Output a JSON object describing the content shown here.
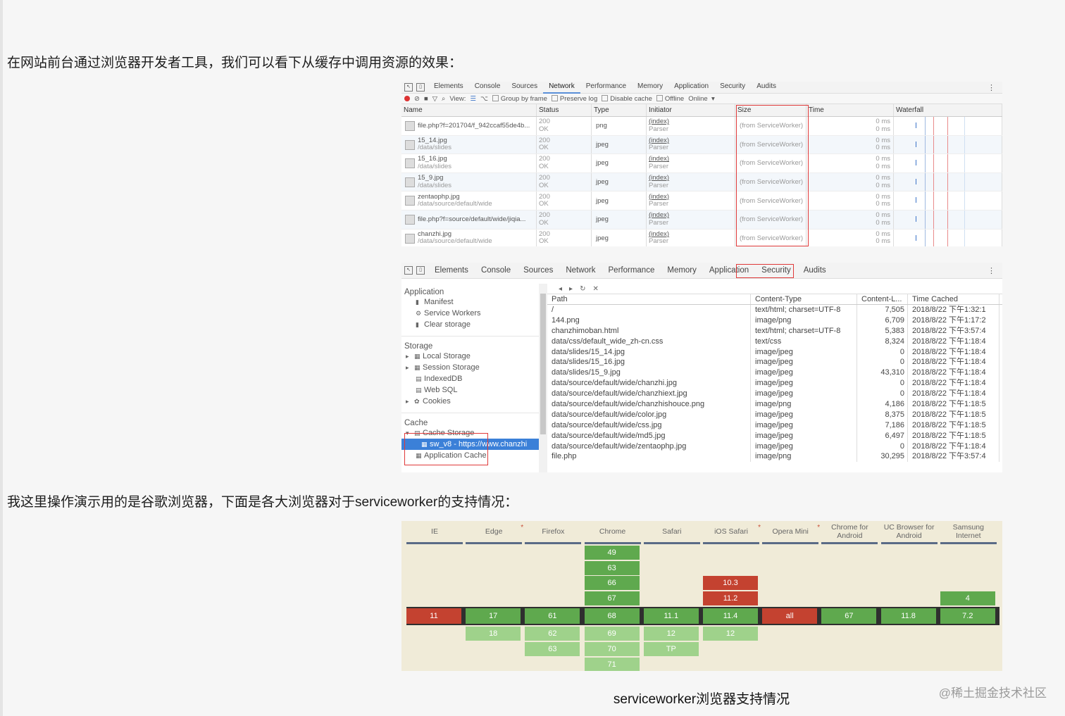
{
  "text": {
    "para1": "在网站前台通过浏览器开发者工具，我们可以看下从缓存中调用资源的效果：",
    "para2": "我这里操作演示用的是谷歌浏览器，下面是各大浏览器对于serviceworker的支持情况：",
    "caption": "serviceworker浏览器支持情况",
    "watermark": "@稀土掘金技术社区"
  },
  "devtools_network": {
    "tabs": [
      "Elements",
      "Console",
      "Sources",
      "Network",
      "Performance",
      "Memory",
      "Application",
      "Security",
      "Audits"
    ],
    "active_tab": "Network",
    "toolbar": {
      "view": "View:",
      "group_by_frame": "Group by frame",
      "preserve_log": "Preserve log",
      "disable_cache": "Disable cache",
      "offline": "Offline",
      "online": "Online"
    },
    "columns": [
      "Name",
      "Status",
      "Type",
      "Initiator",
      "Size",
      "Time",
      "Waterfall"
    ],
    "rows": [
      {
        "name": "file.php?f=201704/f_942ccaf55de4b...",
        "path": "",
        "status": "200",
        "status_text": "OK",
        "type": "png",
        "initiator": "(index)",
        "initiator_sub": "Parser",
        "size": "(from ServiceWorker)",
        "time": "0 ms",
        "latency": "0 ms"
      },
      {
        "name": "15_14.jpg",
        "path": "/data/slides",
        "status": "200",
        "status_text": "OK",
        "type": "jpeg",
        "initiator": "(index)",
        "initiator_sub": "Parser",
        "size": "(from ServiceWorker)",
        "time": "0 ms",
        "latency": "0 ms"
      },
      {
        "name": "15_16.jpg",
        "path": "/data/slides",
        "status": "200",
        "status_text": "OK",
        "type": "jpeg",
        "initiator": "(index)",
        "initiator_sub": "Parser",
        "size": "(from ServiceWorker)",
        "time": "0 ms",
        "latency": "0 ms"
      },
      {
        "name": "15_9.jpg",
        "path": "/data/slides",
        "status": "200",
        "status_text": "OK",
        "type": "jpeg",
        "initiator": "(index)",
        "initiator_sub": "Parser",
        "size": "(from ServiceWorker)",
        "time": "0 ms",
        "latency": "0 ms"
      },
      {
        "name": "zentaophp.jpg",
        "path": "/data/source/default/wide",
        "status": "200",
        "status_text": "OK",
        "type": "jpeg",
        "initiator": "(index)",
        "initiator_sub": "Parser",
        "size": "(from ServiceWorker)",
        "time": "0 ms",
        "latency": "0 ms"
      },
      {
        "name": "file.php?f=source/default/wide/jiqia...",
        "path": "",
        "status": "200",
        "status_text": "OK",
        "type": "jpeg",
        "initiator": "(index)",
        "initiator_sub": "Parser",
        "size": "(from ServiceWorker)",
        "time": "0 ms",
        "latency": "0 ms"
      },
      {
        "name": "chanzhi.jpg",
        "path": "/data/source/default/wide",
        "status": "200",
        "status_text": "OK",
        "type": "jpeg",
        "initiator": "(index)",
        "initiator_sub": "Parser",
        "size": "(from ServiceWorker)",
        "time": "0 ms",
        "latency": "0 ms"
      }
    ]
  },
  "devtools_application": {
    "tabs": [
      "Elements",
      "Console",
      "Sources",
      "Network",
      "Performance",
      "Memory",
      "Application",
      "Security",
      "Audits"
    ],
    "active_tab": "Application",
    "sidebar": {
      "application_title": "Application",
      "application_items": [
        "Manifest",
        "Service Workers",
        "Clear storage"
      ],
      "storage_title": "Storage",
      "storage_items": [
        "Local Storage",
        "Session Storage",
        "IndexedDB",
        "Web SQL",
        "Cookies"
      ],
      "cache_title": "Cache",
      "cache_items": [
        "Cache Storage",
        "sw_v8 - https://www.chanzhi",
        "Application Cache"
      ]
    },
    "columns": [
      "Path",
      "Content-Type",
      "Content-L...",
      "Time Cached"
    ],
    "rows": [
      {
        "path": "/",
        "type": "text/html; charset=UTF-8",
        "length": "7,505",
        "time": "2018/8/22 下午1:32:1"
      },
      {
        "path": "144.png",
        "type": "image/png",
        "length": "6,709",
        "time": "2018/8/22 下午1:17:2"
      },
      {
        "path": "chanzhimoban.html",
        "type": "text/html; charset=UTF-8",
        "length": "5,383",
        "time": "2018/8/22 下午3:57:4"
      },
      {
        "path": "data/css/default_wide_zh-cn.css",
        "type": "text/css",
        "length": "8,324",
        "time": "2018/8/22 下午1:18:4"
      },
      {
        "path": "data/slides/15_14.jpg",
        "type": "image/jpeg",
        "length": "0",
        "time": "2018/8/22 下午1:18:4"
      },
      {
        "path": "data/slides/15_16.jpg",
        "type": "image/jpeg",
        "length": "0",
        "time": "2018/8/22 下午1:18:4"
      },
      {
        "path": "data/slides/15_9.jpg",
        "type": "image/jpeg",
        "length": "43,310",
        "time": "2018/8/22 下午1:18:4"
      },
      {
        "path": "data/source/default/wide/chanzhi.jpg",
        "type": "image/jpeg",
        "length": "0",
        "time": "2018/8/22 下午1:18:4"
      },
      {
        "path": "data/source/default/wide/chanzhiext.jpg",
        "type": "image/jpeg",
        "length": "0",
        "time": "2018/8/22 下午1:18:4"
      },
      {
        "path": "data/source/default/wide/chanzhishouce.png",
        "type": "image/png",
        "length": "4,186",
        "time": "2018/8/22 下午1:18:5"
      },
      {
        "path": "data/source/default/wide/color.jpg",
        "type": "image/jpeg",
        "length": "8,375",
        "time": "2018/8/22 下午1:18:5"
      },
      {
        "path": "data/source/default/wide/css.jpg",
        "type": "image/jpeg",
        "length": "7,186",
        "time": "2018/8/22 下午1:18:5"
      },
      {
        "path": "data/source/default/wide/md5.jpg",
        "type": "image/jpeg",
        "length": "6,497",
        "time": "2018/8/22 下午1:18:5"
      },
      {
        "path": "data/source/default/wide/zentaophp.jpg",
        "type": "image/jpeg",
        "length": "0",
        "time": "2018/8/22 下午1:18:4"
      },
      {
        "path": "file.php",
        "type": "image/png",
        "length": "30,295",
        "time": "2018/8/22 下午3:57:4"
      }
    ]
  },
  "caniuse": {
    "browsers": [
      {
        "name": "IE",
        "star": false,
        "cells": [
          {
            "row": 0,
            "v": "11",
            "s": "r"
          }
        ]
      },
      {
        "name": "Edge",
        "star": true,
        "cells": [
          {
            "row": 0,
            "v": "17",
            "s": "g"
          },
          {
            "row": 1,
            "v": "18",
            "s": "lg"
          }
        ]
      },
      {
        "name": "Firefox",
        "star": false,
        "cells": [
          {
            "row": 0,
            "v": "61",
            "s": "g"
          },
          {
            "row": 1,
            "v": "62",
            "s": "lg"
          },
          {
            "row": 2,
            "v": "63",
            "s": "lg"
          }
        ]
      },
      {
        "name": "Chrome",
        "star": false,
        "cells": [
          {
            "row": -4,
            "v": "49",
            "s": "g"
          },
          {
            "row": -3,
            "v": "63",
            "s": "g"
          },
          {
            "row": -2,
            "v": "66",
            "s": "g"
          },
          {
            "row": -1,
            "v": "67",
            "s": "g"
          },
          {
            "row": 0,
            "v": "68",
            "s": "g"
          },
          {
            "row": 1,
            "v": "69",
            "s": "lg"
          },
          {
            "row": 2,
            "v": "70",
            "s": "lg"
          },
          {
            "row": 3,
            "v": "71",
            "s": "lg"
          }
        ]
      },
      {
        "name": "Safari",
        "star": false,
        "cells": [
          {
            "row": 0,
            "v": "11.1",
            "s": "g"
          },
          {
            "row": 1,
            "v": "12",
            "s": "lg"
          },
          {
            "row": 2,
            "v": "TP",
            "s": "lg"
          }
        ]
      },
      {
        "name": "iOS Safari",
        "star": true,
        "cells": [
          {
            "row": -2,
            "v": "10.3",
            "s": "r"
          },
          {
            "row": -1,
            "v": "11.2",
            "s": "r"
          },
          {
            "row": 0,
            "v": "11.4",
            "s": "g"
          },
          {
            "row": 1,
            "v": "12",
            "s": "lg"
          }
        ]
      },
      {
        "name": "Opera Mini",
        "star": true,
        "cells": [
          {
            "row": 0,
            "v": "all",
            "s": "r"
          }
        ]
      },
      {
        "name": "Chrome for Android",
        "star": false,
        "cells": [
          {
            "row": 0,
            "v": "67",
            "s": "g"
          }
        ]
      },
      {
        "name": "UC Browser for Android",
        "star": false,
        "cells": [
          {
            "row": 0,
            "v": "11.8",
            "s": "g"
          }
        ]
      },
      {
        "name": "Samsung Internet",
        "star": false,
        "cells": [
          {
            "row": -1,
            "v": "4",
            "s": "g"
          },
          {
            "row": 0,
            "v": "7.2",
            "s": "g"
          }
        ]
      }
    ],
    "colors": {
      "supported": "#5fa94e",
      "unsupported": "#c44230",
      "future": "#9fd28b",
      "background": "#f0ebd8"
    }
  },
  "highlight_color": "#e03a3a"
}
